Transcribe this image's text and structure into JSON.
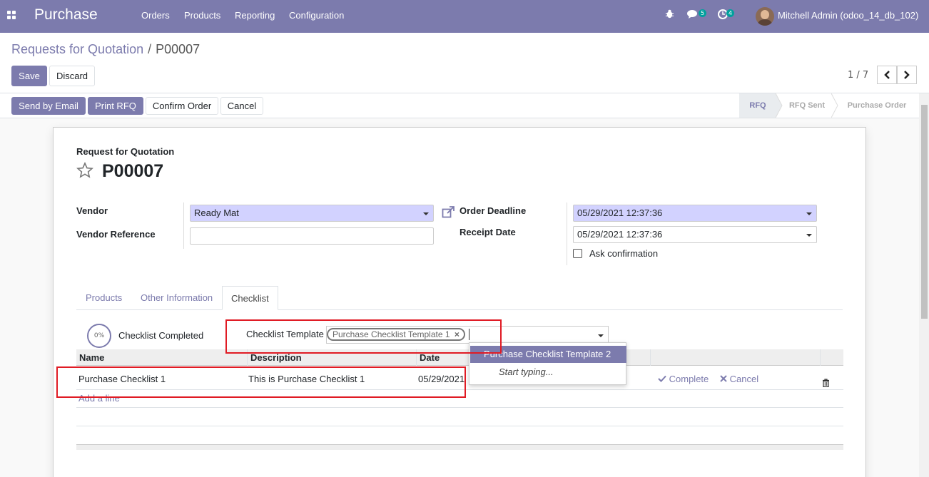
{
  "navbar": {
    "brand": "Purchase",
    "menu": [
      "Orders",
      "Products",
      "Reporting",
      "Configuration"
    ],
    "messages_count": "5",
    "activities_count": "4",
    "user": "Mitchell Admin (odoo_14_db_102)"
  },
  "breadcrumb": {
    "parent": "Requests for Quotation",
    "separator": "/",
    "current": "P00007"
  },
  "buttons": {
    "save": "Save",
    "discard": "Discard",
    "send_email": "Send by Email",
    "print_rfq": "Print RFQ",
    "confirm_order": "Confirm Order",
    "cancel": "Cancel"
  },
  "pager": {
    "value": "1 / 7"
  },
  "stages": [
    {
      "label": "RFQ",
      "active": true
    },
    {
      "label": "RFQ Sent",
      "active": false
    },
    {
      "label": "Purchase Order",
      "active": false
    }
  ],
  "form": {
    "doc_type": "Request for Quotation",
    "doc_name": "P00007",
    "vendor_label": "Vendor",
    "vendor_value": "Ready Mat",
    "vendor_ref_label": "Vendor Reference",
    "vendor_ref_value": "",
    "order_deadline_label": "Order Deadline",
    "order_deadline_value": "05/29/2021 12:37:36",
    "receipt_date_label": "Receipt Date",
    "receipt_date_value": "05/29/2021 12:37:36",
    "ask_confirmation_label": "Ask confirmation"
  },
  "tabs": [
    {
      "label": "Products"
    },
    {
      "label": "Other Information"
    },
    {
      "label": "Checklist",
      "active": true
    }
  ],
  "checklist": {
    "progress": "0%",
    "completed_label": "Checklist Completed",
    "template_label": "Checklist Template",
    "template_tag": "Purchase Checklist Template 1",
    "columns": [
      "Name",
      "Description",
      "Date"
    ],
    "rows": [
      {
        "name": "Purchase Checklist 1",
        "description": "This is Purchase Checklist 1",
        "date": "05/29/2021",
        "complete": "Complete",
        "cancel": "Cancel"
      }
    ],
    "add_line": "Add a line"
  },
  "dropdown": {
    "options": [
      "Purchase Checklist Template 2"
    ],
    "hint": "Start typing..."
  },
  "colors": {
    "brand": "#7c7bad",
    "required_field": "#d2d2ff",
    "annotation": "#e01b24"
  }
}
